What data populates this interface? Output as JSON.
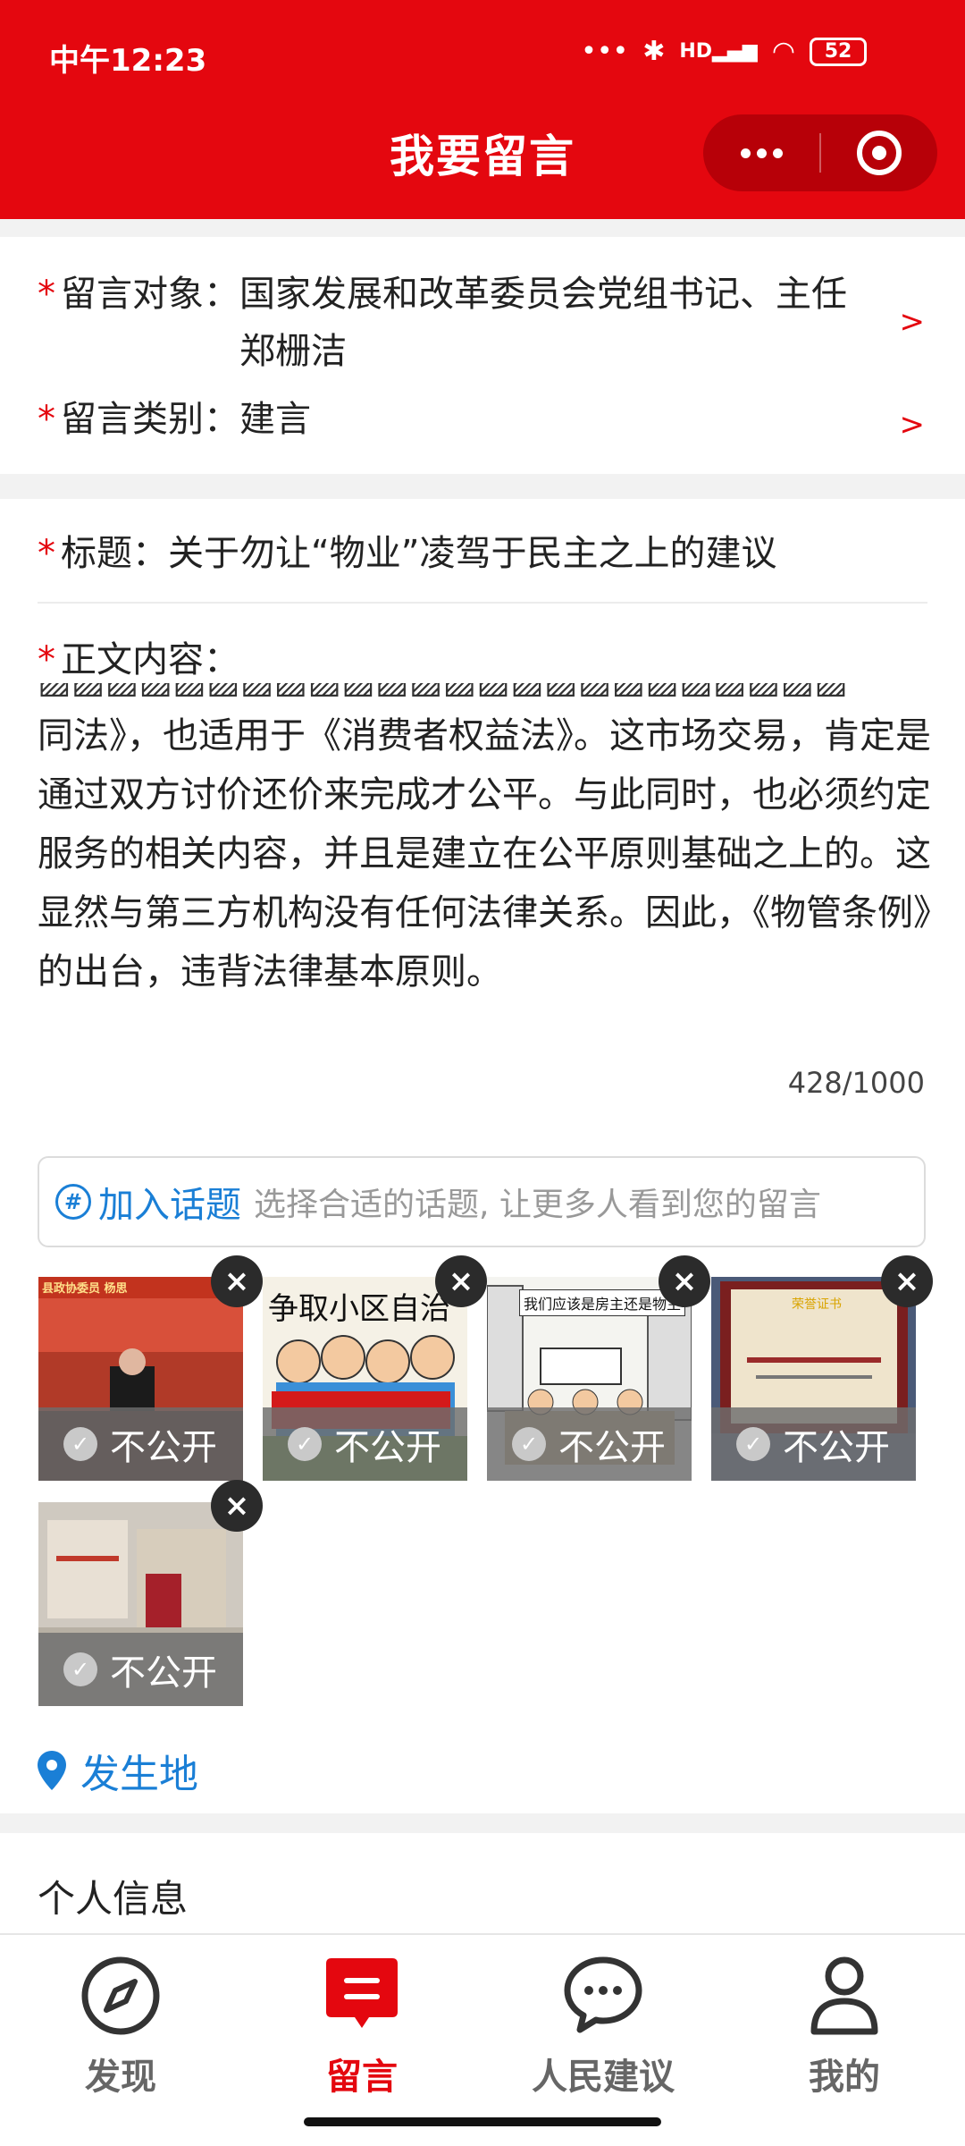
{
  "status": {
    "time": "中午12:23",
    "battery": "52",
    "net": "HD"
  },
  "header": {
    "title": "我要留言"
  },
  "form": {
    "target_label": "留言对象：",
    "target_value": "国家发展和改革委员会党组书记、主任郑栅洁",
    "category_label": "留言类别：",
    "category_value": "建言",
    "title_label": "标题：",
    "title_value": "关于勿让“物业”凌驾于民主之上的建议",
    "content_label": "正文内容：",
    "content_text": "同法》，也适用于《消费者权益法》。这市场交易，肯定是通过双方讨价还价来完成才公平。与此同时，也必须约定服务的相关内容，并且是建立在公平原则基础之上的。这显然与第三方机构没有任何法律关系。因此，《物管条例》的出台，违背法律基本原则。",
    "content_count": "428/1000",
    "chevron": ">"
  },
  "topic": {
    "label": "加入话题",
    "placeholder": "选择合适的话题, 让更多人看到您的留言"
  },
  "attachments": [
    {
      "privacy": "不公开",
      "caption": "县政协委员 杨思"
    },
    {
      "privacy": "不公开",
      "caption": "争取小区自治"
    },
    {
      "privacy": "不公开",
      "caption": "我们应该是房主还是物主"
    },
    {
      "privacy": "不公开",
      "caption": "荣誉证书"
    },
    {
      "privacy": "不公开",
      "caption": ""
    }
  ],
  "location": {
    "label": "发生地"
  },
  "personal": {
    "label": "个人信息"
  },
  "tabs": [
    {
      "label": "发现"
    },
    {
      "label": "留言"
    },
    {
      "label": "人民建议"
    },
    {
      "label": "我的"
    }
  ],
  "colors": {
    "brand": "#e4070f",
    "link": "#1a7fd6"
  }
}
